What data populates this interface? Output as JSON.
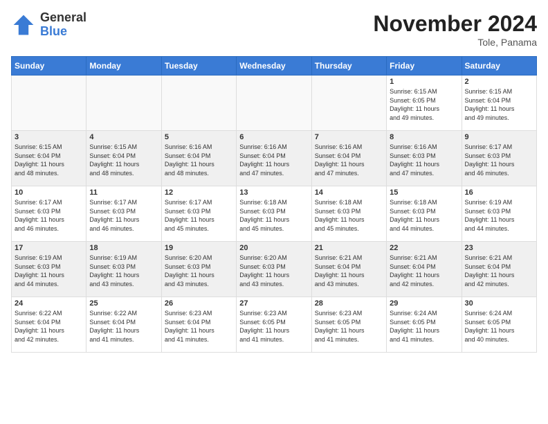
{
  "header": {
    "logo_general": "General",
    "logo_blue": "Blue",
    "month_title": "November 2024",
    "location": "Tole, Panama"
  },
  "days_of_week": [
    "Sunday",
    "Monday",
    "Tuesday",
    "Wednesday",
    "Thursday",
    "Friday",
    "Saturday"
  ],
  "weeks": [
    [
      {
        "day": "",
        "info": ""
      },
      {
        "day": "",
        "info": ""
      },
      {
        "day": "",
        "info": ""
      },
      {
        "day": "",
        "info": ""
      },
      {
        "day": "",
        "info": ""
      },
      {
        "day": "1",
        "info": "Sunrise: 6:15 AM\nSunset: 6:05 PM\nDaylight: 11 hours\nand 49 minutes."
      },
      {
        "day": "2",
        "info": "Sunrise: 6:15 AM\nSunset: 6:04 PM\nDaylight: 11 hours\nand 49 minutes."
      }
    ],
    [
      {
        "day": "3",
        "info": "Sunrise: 6:15 AM\nSunset: 6:04 PM\nDaylight: 11 hours\nand 48 minutes."
      },
      {
        "day": "4",
        "info": "Sunrise: 6:15 AM\nSunset: 6:04 PM\nDaylight: 11 hours\nand 48 minutes."
      },
      {
        "day": "5",
        "info": "Sunrise: 6:16 AM\nSunset: 6:04 PM\nDaylight: 11 hours\nand 48 minutes."
      },
      {
        "day": "6",
        "info": "Sunrise: 6:16 AM\nSunset: 6:04 PM\nDaylight: 11 hours\nand 47 minutes."
      },
      {
        "day": "7",
        "info": "Sunrise: 6:16 AM\nSunset: 6:04 PM\nDaylight: 11 hours\nand 47 minutes."
      },
      {
        "day": "8",
        "info": "Sunrise: 6:16 AM\nSunset: 6:03 PM\nDaylight: 11 hours\nand 47 minutes."
      },
      {
        "day": "9",
        "info": "Sunrise: 6:17 AM\nSunset: 6:03 PM\nDaylight: 11 hours\nand 46 minutes."
      }
    ],
    [
      {
        "day": "10",
        "info": "Sunrise: 6:17 AM\nSunset: 6:03 PM\nDaylight: 11 hours\nand 46 minutes."
      },
      {
        "day": "11",
        "info": "Sunrise: 6:17 AM\nSunset: 6:03 PM\nDaylight: 11 hours\nand 46 minutes."
      },
      {
        "day": "12",
        "info": "Sunrise: 6:17 AM\nSunset: 6:03 PM\nDaylight: 11 hours\nand 45 minutes."
      },
      {
        "day": "13",
        "info": "Sunrise: 6:18 AM\nSunset: 6:03 PM\nDaylight: 11 hours\nand 45 minutes."
      },
      {
        "day": "14",
        "info": "Sunrise: 6:18 AM\nSunset: 6:03 PM\nDaylight: 11 hours\nand 45 minutes."
      },
      {
        "day": "15",
        "info": "Sunrise: 6:18 AM\nSunset: 6:03 PM\nDaylight: 11 hours\nand 44 minutes."
      },
      {
        "day": "16",
        "info": "Sunrise: 6:19 AM\nSunset: 6:03 PM\nDaylight: 11 hours\nand 44 minutes."
      }
    ],
    [
      {
        "day": "17",
        "info": "Sunrise: 6:19 AM\nSunset: 6:03 PM\nDaylight: 11 hours\nand 44 minutes."
      },
      {
        "day": "18",
        "info": "Sunrise: 6:19 AM\nSunset: 6:03 PM\nDaylight: 11 hours\nand 43 minutes."
      },
      {
        "day": "19",
        "info": "Sunrise: 6:20 AM\nSunset: 6:03 PM\nDaylight: 11 hours\nand 43 minutes."
      },
      {
        "day": "20",
        "info": "Sunrise: 6:20 AM\nSunset: 6:03 PM\nDaylight: 11 hours\nand 43 minutes."
      },
      {
        "day": "21",
        "info": "Sunrise: 6:21 AM\nSunset: 6:04 PM\nDaylight: 11 hours\nand 43 minutes."
      },
      {
        "day": "22",
        "info": "Sunrise: 6:21 AM\nSunset: 6:04 PM\nDaylight: 11 hours\nand 42 minutes."
      },
      {
        "day": "23",
        "info": "Sunrise: 6:21 AM\nSunset: 6:04 PM\nDaylight: 11 hours\nand 42 minutes."
      }
    ],
    [
      {
        "day": "24",
        "info": "Sunrise: 6:22 AM\nSunset: 6:04 PM\nDaylight: 11 hours\nand 42 minutes."
      },
      {
        "day": "25",
        "info": "Sunrise: 6:22 AM\nSunset: 6:04 PM\nDaylight: 11 hours\nand 41 minutes."
      },
      {
        "day": "26",
        "info": "Sunrise: 6:23 AM\nSunset: 6:04 PM\nDaylight: 11 hours\nand 41 minutes."
      },
      {
        "day": "27",
        "info": "Sunrise: 6:23 AM\nSunset: 6:05 PM\nDaylight: 11 hours\nand 41 minutes."
      },
      {
        "day": "28",
        "info": "Sunrise: 6:23 AM\nSunset: 6:05 PM\nDaylight: 11 hours\nand 41 minutes."
      },
      {
        "day": "29",
        "info": "Sunrise: 6:24 AM\nSunset: 6:05 PM\nDaylight: 11 hours\nand 41 minutes."
      },
      {
        "day": "30",
        "info": "Sunrise: 6:24 AM\nSunset: 6:05 PM\nDaylight: 11 hours\nand 40 minutes."
      }
    ]
  ]
}
